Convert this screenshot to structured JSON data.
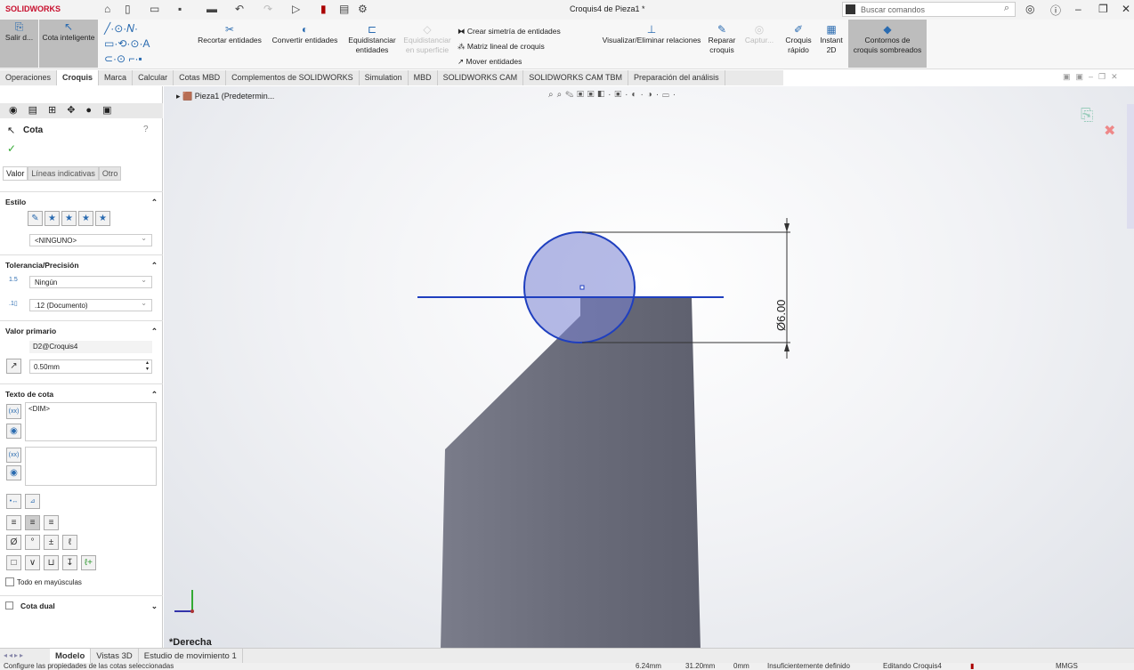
{
  "app": {
    "logo": "SOLIDWORKS",
    "title": "Croquis4 de Pieza1 *",
    "search_placeholder": "Buscar comandos"
  },
  "ribbon": {
    "salir": "Salir d...",
    "cota": "Cota inteligente",
    "recortar": "Recortar entidades",
    "convertir": "Convertir entidades",
    "equid1": "Equidistanciar",
    "equid2": "entidades",
    "equidsup1": "Equidistanciar",
    "equidsup2": "en superficie",
    "simetria": "Crear simetría de entidades",
    "matriz": "Matriz lineal de croquis",
    "mover": "Mover entidades",
    "visualizar": "Visualizar/Eliminar relaciones",
    "reparar1": "Reparar",
    "reparar2": "croquis",
    "captura": "Captur...",
    "rapido1": "Croquis",
    "rapido2": "rápido",
    "instant1": "Instant",
    "instant2": "2D",
    "contornos1": "Contornos de",
    "contornos2": "croquis sombreados"
  },
  "tabs": [
    "Operaciones",
    "Croquis",
    "Marca",
    "Calcular",
    "Cotas MBD",
    "Complementos de SOLIDWORKS",
    "Simulation",
    "MBD",
    "SOLIDWORKS CAM",
    "SOLIDWORKS CAM TBM",
    "Preparación del análisis"
  ],
  "tree": {
    "item": "Pieza1 (Predetermin..."
  },
  "panel": {
    "title": "Cota",
    "tabs": [
      "Valor",
      "Líneas indicativas",
      "Otro"
    ],
    "estilo": "Estilo",
    "estilo_value": "<NINGUNO>",
    "tolerancia": "Tolerancia/Precisión",
    "tol_value": "Ningún",
    "prec_value": ".12 (Documento)",
    "valor_primario": "Valor primario",
    "ref": "D2@Croquis4",
    "value": "0.50mm",
    "texto": "Texto de cota",
    "dim": "<DIM>",
    "mayusculas": "Todo en mayúsculas",
    "dual": "Cota dual"
  },
  "viewport": {
    "dimension": "Ø6.00",
    "view_name": "*Derecha"
  },
  "bottom_tabs": [
    "Modelo",
    "Vistas 3D",
    "Estudio de movimiento 1"
  ],
  "status": {
    "message": "Configure las propiedades de las cotas seleccionadas",
    "x": "6.24mm",
    "y": "31.20mm",
    "z": "0mm",
    "state": "Insuficientemente definido",
    "editing": "Editando Croquis4",
    "units": "MMGS"
  },
  "colors": {
    "sketch": "#1f3fbf",
    "part": "#6e7080",
    "accent": "#c8102e"
  }
}
